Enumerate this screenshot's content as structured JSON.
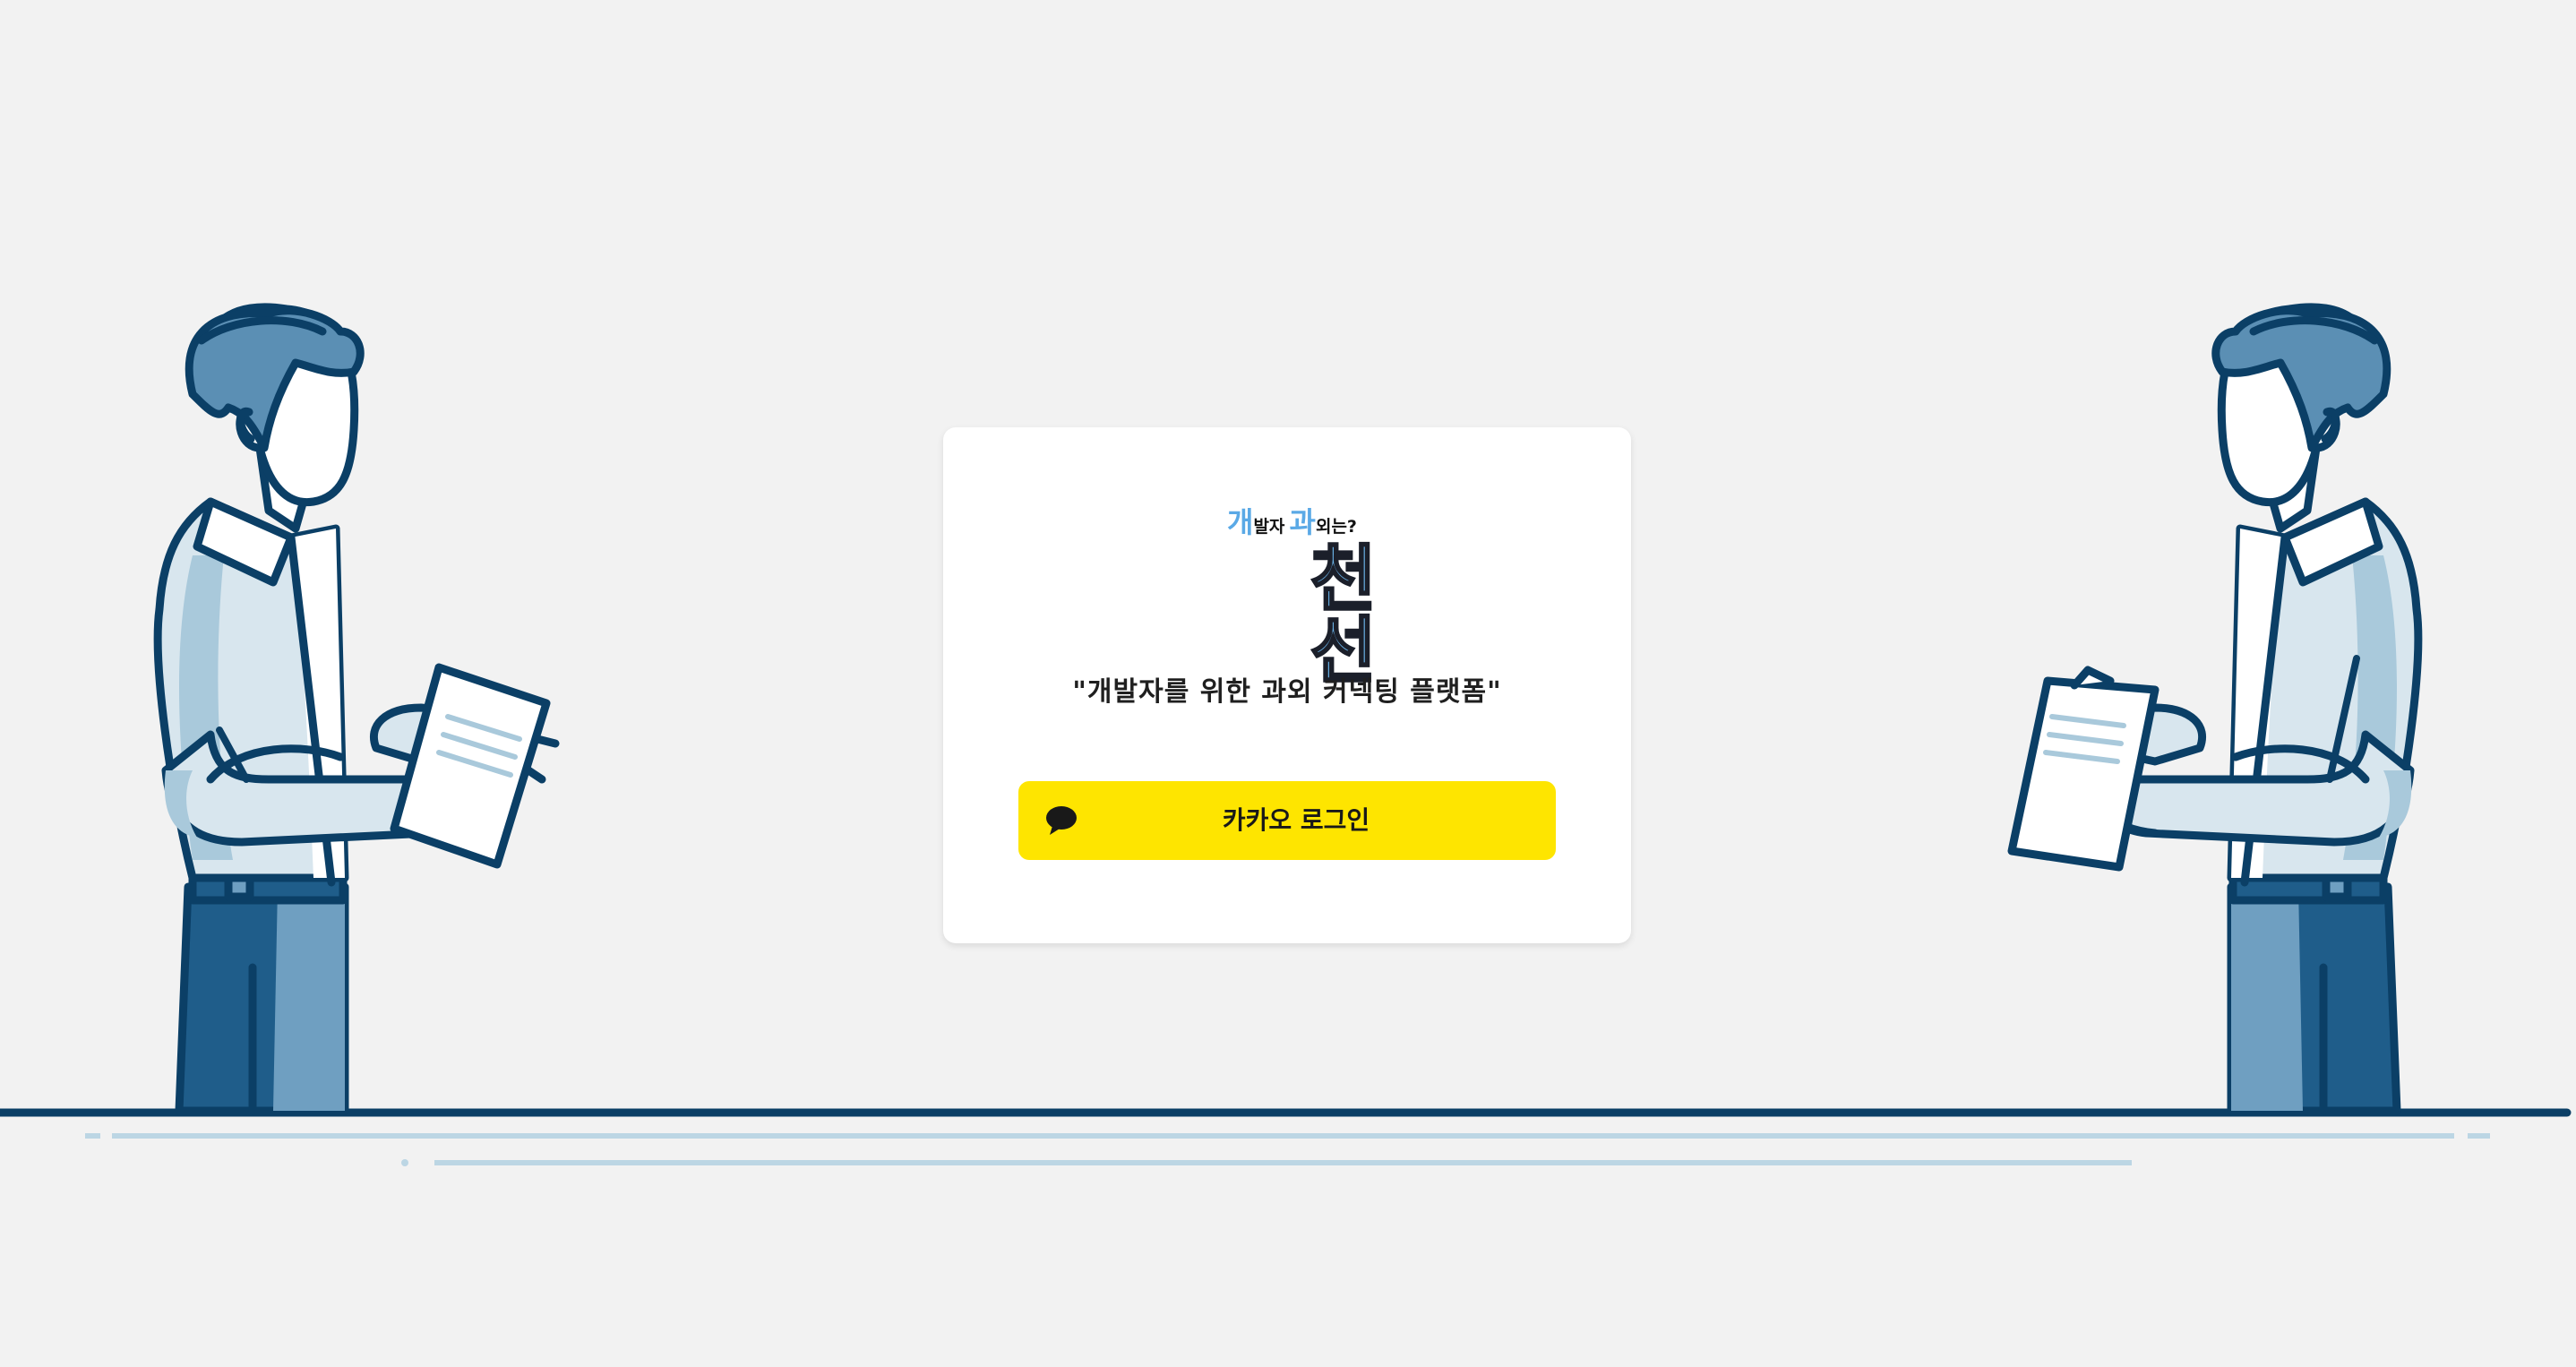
{
  "logo": {
    "dev_char": "개",
    "dev_rest": "발자",
    "tutor_char": "과",
    "tutor_rest": "외는?",
    "main": "천선"
  },
  "tagline": "\"개발자를 위한 과외 커넥팅 플랫폼\"",
  "login": {
    "kakao_label": "카카오 로그인",
    "kakao_color": "#fee500",
    "icon": "speech-bubble-icon"
  },
  "colors": {
    "background": "#f2f2f2",
    "card": "#ffffff",
    "accent": "#5aa9e6",
    "illustration_dark": "#0b3f66",
    "illustration_light": "#a9c9db"
  }
}
